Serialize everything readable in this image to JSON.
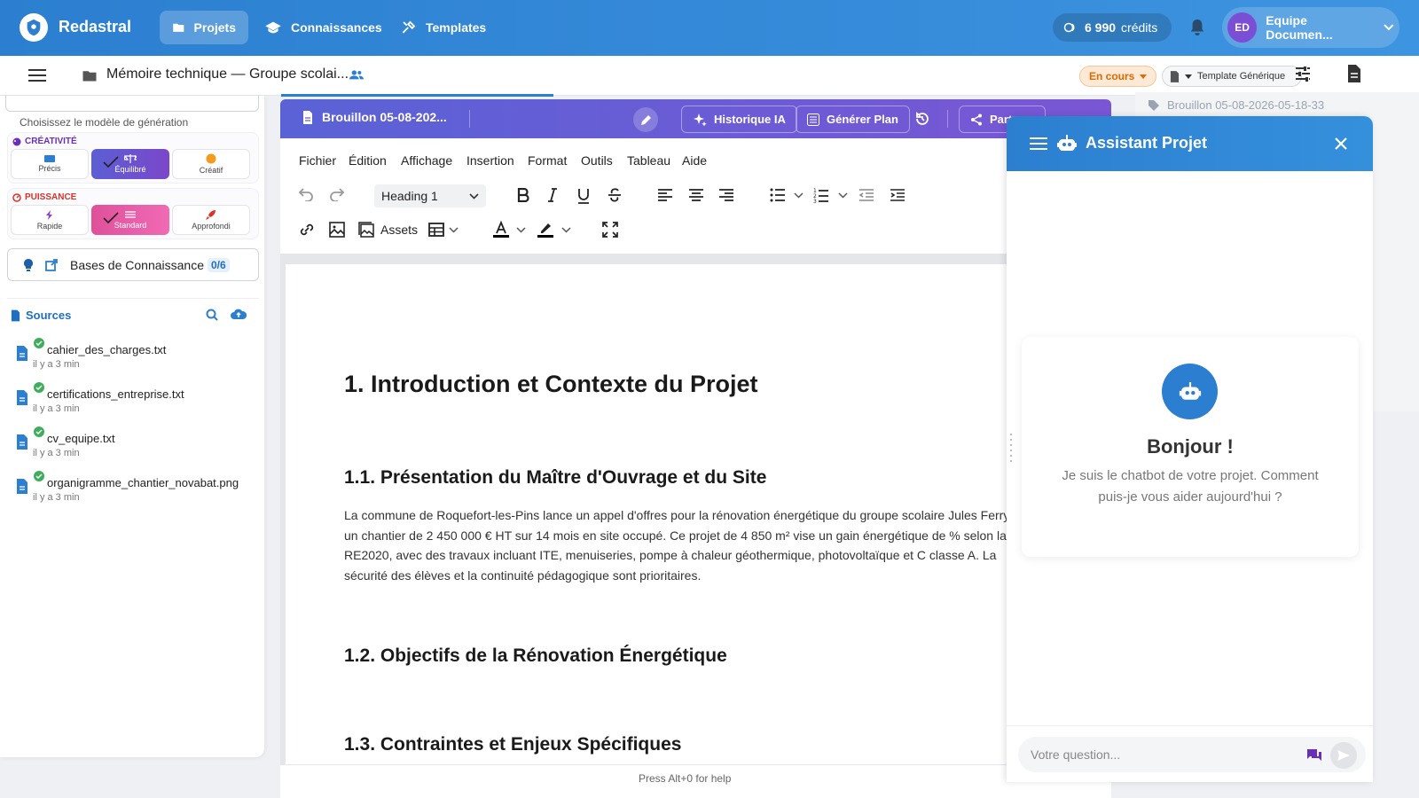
{
  "app": {
    "brand": "Redastral",
    "credits_value": "6 990",
    "credits_label": "crédits",
    "user_initials": "ED",
    "user_name": "Equipe Documen..."
  },
  "nav": {
    "projets": "Projets",
    "connaissances": "Connaissances",
    "templates": "Templates"
  },
  "subbar": {
    "doc_title": "Mémoire technique — Groupe scolai...",
    "status": "En cours",
    "template": "Template Générique"
  },
  "left": {
    "model_hint": "Choisissez le modèle de génération",
    "creativity": {
      "label": "CRÉATIVITÉ",
      "options": [
        "Précis",
        "Équilibré",
        "Créatif"
      ]
    },
    "power": {
      "label": "PUISSANCE",
      "options": [
        "Rapide",
        "Standard",
        "Approfondi"
      ]
    },
    "kb_label": "Bases de Connaissance",
    "kb_count": "0/6",
    "sources_label": "Sources",
    "sources": [
      {
        "name": "cahier_des_charges.txt",
        "time": "il y a 3 min"
      },
      {
        "name": "certifications_entreprise.txt",
        "time": "il y a 3 min"
      },
      {
        "name": "cv_equipe.txt",
        "time": "il y a 3 min"
      },
      {
        "name": "organigramme_chantier_novabat.png",
        "time": "il y a 3 min"
      }
    ]
  },
  "editor": {
    "draft_title": "Brouillon 05-08-202...",
    "btn_historique": "Historique IA",
    "btn_plan": "Générer Plan",
    "btn_partial": "Part",
    "menus": [
      "Fichier",
      "Édition",
      "Affichage",
      "Insertion",
      "Format",
      "Outils",
      "Tableau",
      "Aide"
    ],
    "heading_select": "Heading 1",
    "assets": "Assets",
    "help": "Press Alt+0 for help"
  },
  "document": {
    "h1": "1. Introduction et Contexte du Projet",
    "h2_1": "1.1. Présentation du Maître d'Ouvrage et du Site",
    "para": "La commune de Roquefort-les-Pins lance un appel d'offres pour la rénovation énergétique du groupe scolaire Jules Ferry, un chantier de 2 450 000 € HT sur 14 mois en site occupé. Ce projet de 4 850 m² vise un gain énergétique de % selon la RE2020, avec des travaux incluant ITE, menuiseries, pompe à chaleur géothermique, photovoltaïque et C classe A. La sécurité des élèves et la continuité pédagogique sont prioritaires.",
    "h2_2": "1.2. Objectifs de la Rénovation Énergétique",
    "h2_3": "1.3. Contraintes et Enjeux Spécifiques"
  },
  "right_panel": {
    "draft": "Brouillon 05-08-2026-05-18-33"
  },
  "assistant": {
    "title": "Assistant Projet",
    "greeting": "Bonjour !",
    "message": "Je suis le chatbot de votre projet. Comment puis-je vous aider aujourd'hui ?",
    "placeholder": "Votre question..."
  },
  "colors": {
    "primary": "#2c7fd0",
    "editor_header": "#6a5cd5",
    "status_orange": "#e06b00",
    "pink": "#e0509a",
    "purple": "#5b5fd4"
  }
}
